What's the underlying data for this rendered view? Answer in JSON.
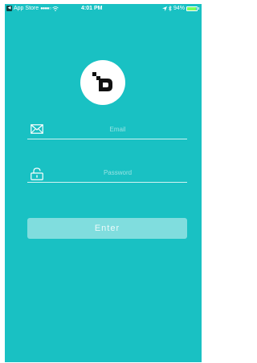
{
  "status_bar": {
    "back_app": "App Store",
    "signal": "●●●●○",
    "time": "4:01 PM",
    "battery_percent": "94%",
    "battery_level": 0.94
  },
  "logo": {
    "icon": "app-logo-icon"
  },
  "login_form": {
    "email_placeholder": "Email",
    "email_value": "",
    "email_icon": "envelope-icon",
    "password_placeholder": "Password",
    "password_value": "",
    "password_icon": "lock-icon",
    "enter_label": "Enter"
  },
  "colors": {
    "background": "#19c1c3",
    "button": "#8fdfe0"
  }
}
